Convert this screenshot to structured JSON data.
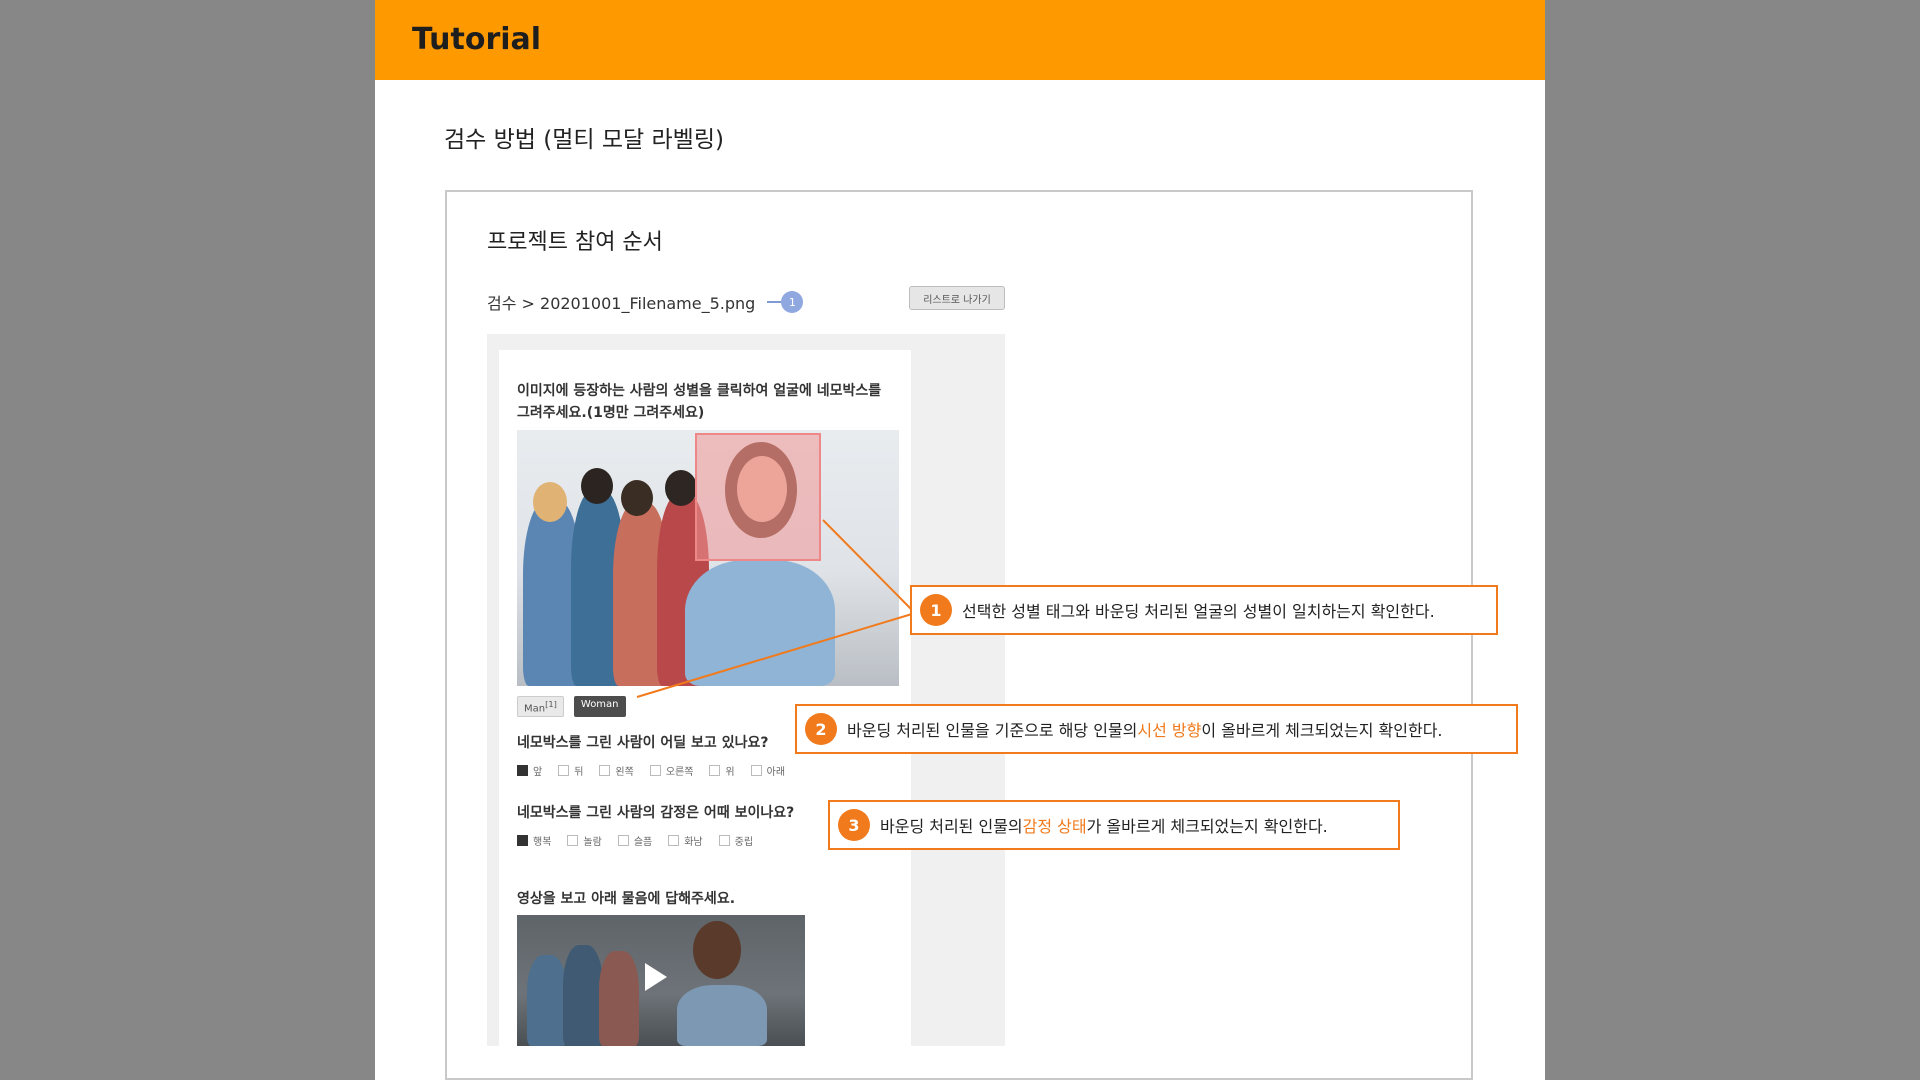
{
  "header": {
    "title": "Tutorial"
  },
  "section_title": "검수 방법 (멀티 모달 라벨링)",
  "frame": {
    "title": "프로젝트 참여 순서",
    "breadcrumb": "검수 > 20201001_Filename_5.png",
    "breadcrumb_marker": "1",
    "list_button": "리스트로 나가기"
  },
  "card": {
    "question1": "이미지에 등장하는 사람의 성별을 클릭하여 얼굴에 네모박스를 그려주세요.(1명만 그려주세요)",
    "tags": [
      {
        "label": "Man",
        "count": "[1]",
        "selected": false
      },
      {
        "label": "Woman",
        "selected": true
      }
    ],
    "question2": "네모박스를 그린 사람이 어딜 보고 있나요?",
    "gaze_options": [
      {
        "label": "앞",
        "checked": true
      },
      {
        "label": "뒤",
        "checked": false
      },
      {
        "label": "왼쪽",
        "checked": false
      },
      {
        "label": "오른쪽",
        "checked": false
      },
      {
        "label": "위",
        "checked": false
      },
      {
        "label": "아래",
        "checked": false
      }
    ],
    "question3": "네모박스를 그린 사람의 감정은 어때 보이나요?",
    "emotion_options": [
      {
        "label": "행복",
        "checked": true
      },
      {
        "label": "놀람",
        "checked": false
      },
      {
        "label": "슬픔",
        "checked": false
      },
      {
        "label": "화남",
        "checked": false
      },
      {
        "label": "중립",
        "checked": false
      }
    ],
    "video_title": "영상을 보고 아래 물음에 답해주세요."
  },
  "callouts": [
    {
      "number": "1",
      "before": "선택한 성별 태그와 바운딩 처리된 얼굴의 성별이 일치하는지 확인한다.",
      "highlight": "",
      "after": ""
    },
    {
      "number": "2",
      "before": "바운딩 처리된 인물을 기준으로 해당 인물의 ",
      "highlight": "시선 방향",
      "after": "이 올바르게 체크되었는지 확인한다."
    },
    {
      "number": "3",
      "before": "바운딩 처리된 인물의 ",
      "highlight": "감정 상태",
      "after": "가 올바르게 체크되었는지 확인한다."
    }
  ],
  "colors": {
    "header": "#ff9900",
    "accent": "#f07a1c",
    "background": "#878787"
  }
}
